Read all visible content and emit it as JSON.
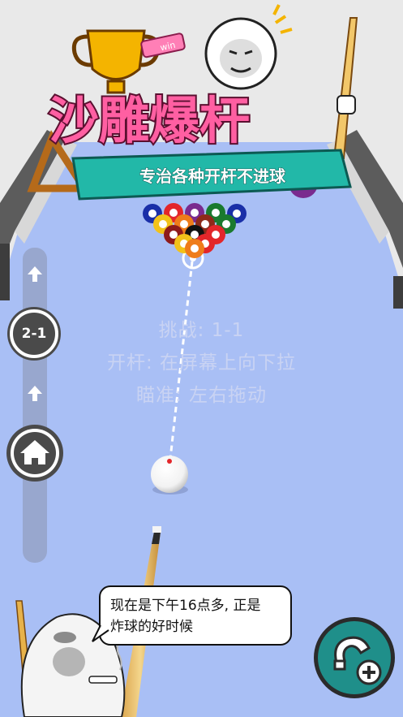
{
  "title": {
    "main": "沙雕爆杆",
    "banner": "专治各种开杆不进球",
    "win_tag": "win"
  },
  "level": {
    "badge": "2-1"
  },
  "instructions": {
    "challenge": "挑战: 1-1",
    "break": "开杆: 在屏幕上向下拉",
    "aim": "瞄准: 左右拖动"
  },
  "speech": {
    "line1": "现在是下午16点多, 正是",
    "line2": "炸球的好时候"
  },
  "icons": {
    "up_arrow_top": "arrow-up-icon",
    "up_arrow_bottom": "arrow-up-icon",
    "home": "home-icon",
    "magnet": "magnet-plus-icon"
  },
  "colors": {
    "table_felt": "#a9bff5",
    "rail": "#585858",
    "banner": "#22b8a8",
    "title_pink": "#ff5fa2",
    "magnet_button": "#1f8f8a"
  }
}
